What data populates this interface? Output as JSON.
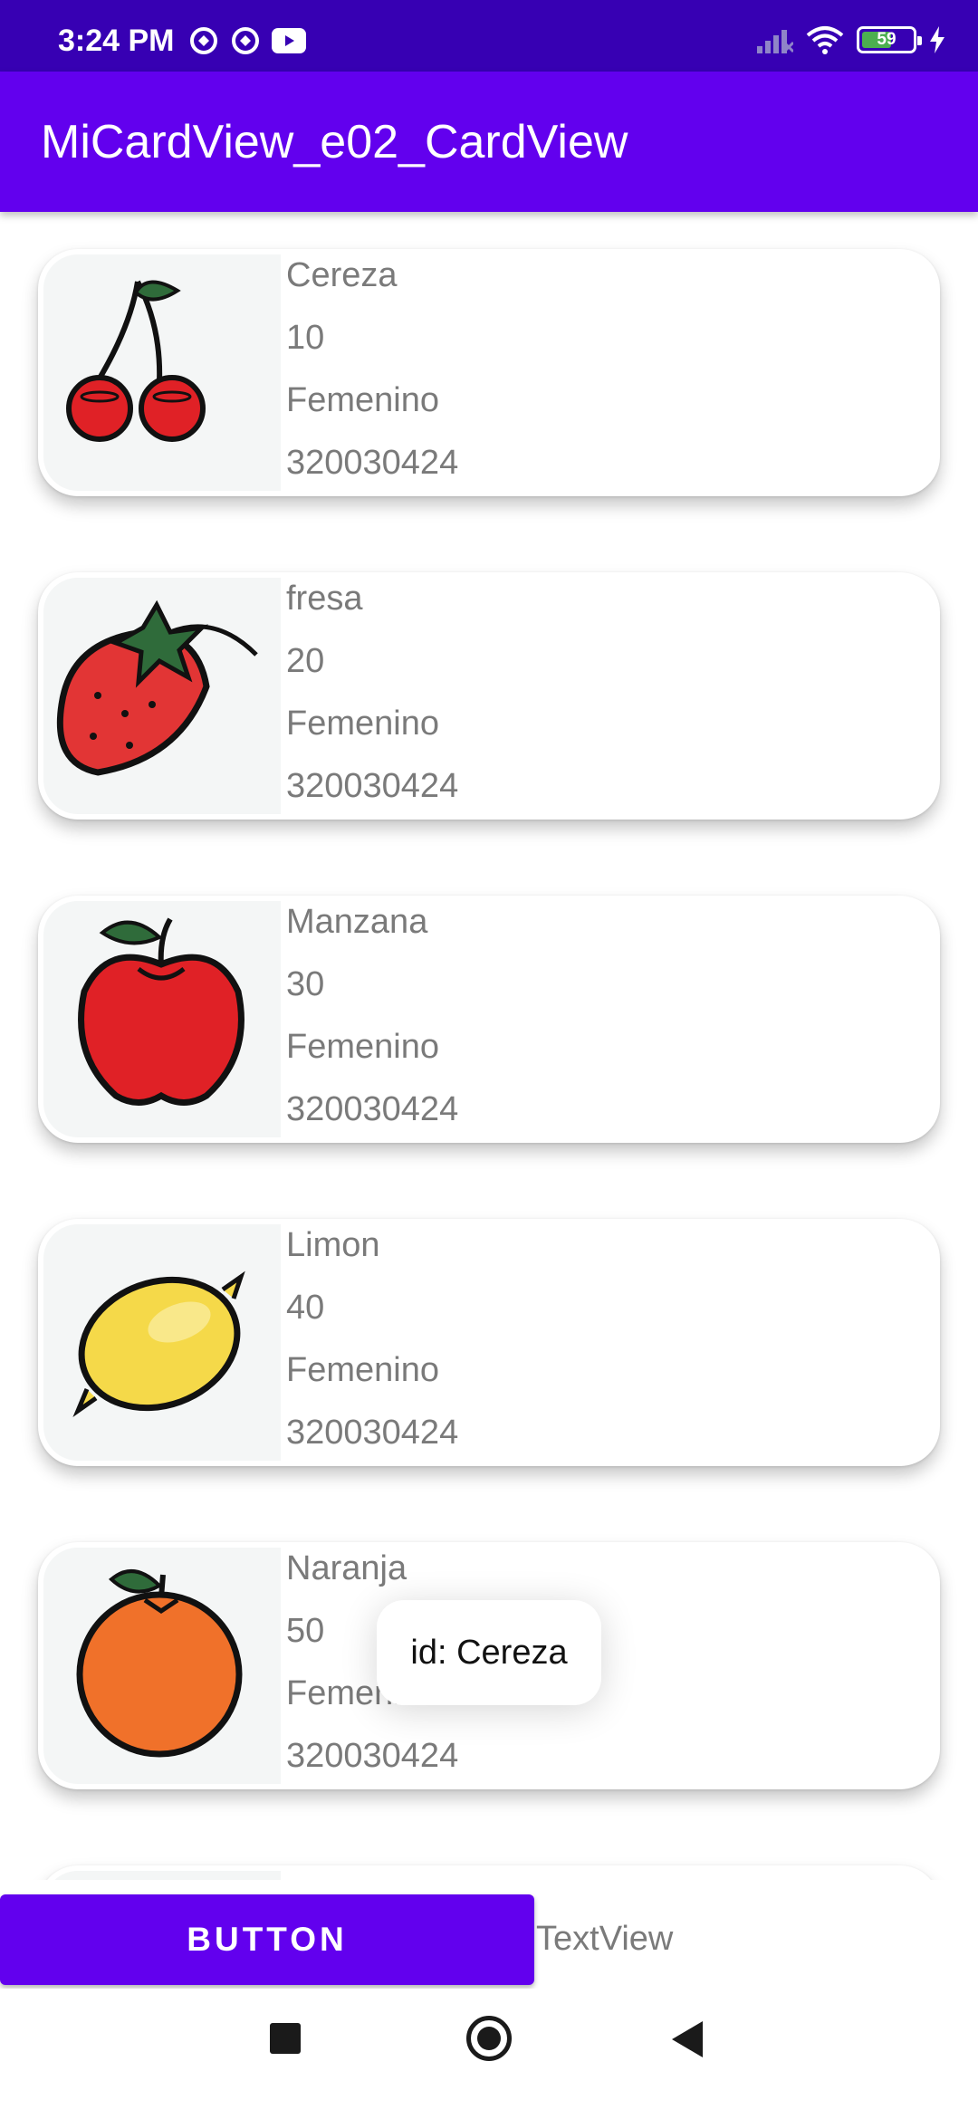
{
  "status_bar": {
    "time": "3:24 PM",
    "battery": "59",
    "battery_level": 0.59,
    "left_icons": [
      "data-saver-icon",
      "data-saver-icon",
      "youtube-icon"
    ],
    "right_icons": [
      "signal-icon",
      "wifi-icon",
      "battery-icon",
      "charging-icon"
    ]
  },
  "app_bar": {
    "title": "MiCardView_e02_CardView"
  },
  "cards": [
    {
      "name": "Cereza",
      "number": "10",
      "gender": "Femenino",
      "id": "320030424",
      "icon": "cherry-icon"
    },
    {
      "name": "fresa",
      "number": "20",
      "gender": "Femenino",
      "id": "320030424",
      "icon": "strawberry-icon"
    },
    {
      "name": "Manzana",
      "number": "30",
      "gender": "Femenino",
      "id": "320030424",
      "icon": "apple-icon"
    },
    {
      "name": "Limon",
      "number": "40",
      "gender": "Femenino",
      "id": "320030424",
      "icon": "lemon-icon"
    },
    {
      "name": "Naranja",
      "number": "50",
      "gender": "Femenino",
      "id": "320030424",
      "icon": "orange-icon"
    }
  ],
  "bottom": {
    "button_label": "BUTTON",
    "textview": "TextView"
  },
  "toast": {
    "text": "id: Cereza"
  },
  "nav_bar": {
    "icons": [
      "recents-icon",
      "home-icon",
      "back-icon"
    ]
  },
  "colors": {
    "status_bar": "#3700b3",
    "primary": "#6200ee",
    "card_text": "#7a7a7a"
  }
}
